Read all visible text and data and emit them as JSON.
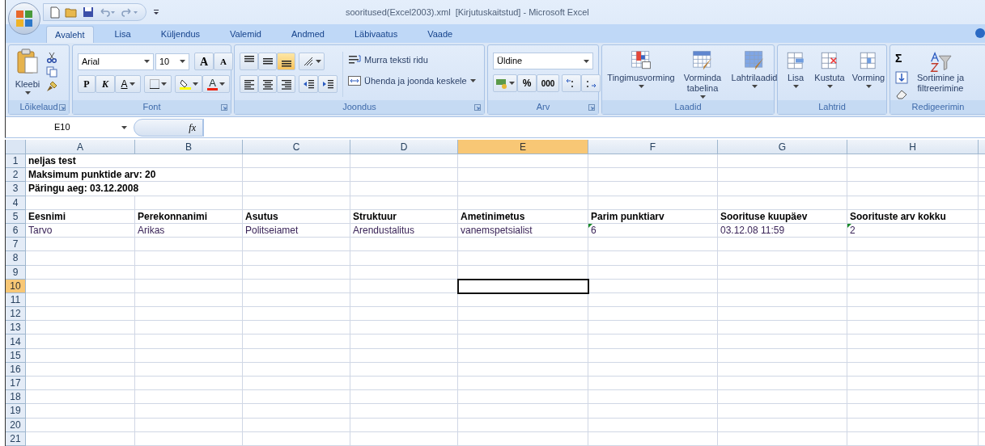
{
  "window": {
    "title": "sooritused(Excel2003).xml  [Kirjutuskaitstud] - Microsoft Excel"
  },
  "tabs": [
    {
      "label": "Avaleht",
      "selected": true
    },
    {
      "label": "Lisa",
      "selected": false
    },
    {
      "label": "Küljendus",
      "selected": false
    },
    {
      "label": "Valemid",
      "selected": false
    },
    {
      "label": "Andmed",
      "selected": false
    },
    {
      "label": "Läbivaatus",
      "selected": false
    },
    {
      "label": "Vaade",
      "selected": false
    }
  ],
  "ribbon": {
    "groups": [
      {
        "kind": "clipboard",
        "label": "Lõikelaud",
        "paste_label": "Kleebi"
      },
      {
        "kind": "font",
        "label": "Font",
        "font_name": "Arial",
        "font_size": "10",
        "grow_key": "A",
        "shrink_key": "A",
        "bold_key": "P",
        "italic_key": "K",
        "underline_key": "A",
        "font_color_key": "A"
      },
      {
        "kind": "alignment",
        "label": "Joondus",
        "vertical": [
          {
            "selected": false
          },
          {
            "selected": false
          },
          {
            "selected": true
          }
        ],
        "wrap_label": "Murra teksti ridu",
        "merge_label": "Ühenda ja joonda keskele"
      },
      {
        "kind": "number",
        "label": "Arv",
        "format": "Üldine",
        "percent_key": "%",
        "thousands_key": "000"
      },
      {
        "kind": "styles",
        "label": "Laadid",
        "buttons": [
          {
            "label": "Tingimusvorming"
          },
          {
            "label": "Vorminda tabelina"
          },
          {
            "label": "Lahtrilaadid"
          }
        ]
      },
      {
        "kind": "cells",
        "label": "Lahtrid",
        "buttons": [
          {
            "label": "Lisa"
          },
          {
            "label": "Kustuta"
          },
          {
            "label": "Vorming"
          }
        ]
      },
      {
        "kind": "editing",
        "label": "Redigeerimin",
        "sum_key": "Σ",
        "sort_label": "Sortimine ja filtreerimine"
      }
    ]
  },
  "formula_bar": {
    "name_box": "E10",
    "fx": "fx"
  },
  "sheet": {
    "columns": [
      {
        "label": "A",
        "selected": false
      },
      {
        "label": "B",
        "selected": false
      },
      {
        "label": "C",
        "selected": false
      },
      {
        "label": "D",
        "selected": false
      },
      {
        "label": "E",
        "selected": true
      },
      {
        "label": "F",
        "selected": false
      },
      {
        "label": "G",
        "selected": false
      },
      {
        "label": "H",
        "selected": false
      }
    ],
    "rows": [
      {
        "number": "1",
        "selected": false,
        "kind": "heading",
        "cells": [
          {
            "text": "neljas test"
          }
        ]
      },
      {
        "number": "2",
        "selected": false,
        "kind": "heading",
        "cells": [
          {
            "text": "Maksimum punktide arv: 20"
          }
        ]
      },
      {
        "number": "3",
        "selected": false,
        "kind": "heading",
        "cells": [
          {
            "text": "Päringu aeg: 03.12.2008"
          }
        ]
      },
      {
        "number": "4",
        "selected": false,
        "kind": "empty"
      },
      {
        "number": "5",
        "selected": false,
        "kind": "heading",
        "cells": [
          {
            "text": "Eesnimi"
          },
          {
            "text": "Perekonnanimi"
          },
          {
            "text": "Asutus"
          },
          {
            "text": "Struktuur"
          },
          {
            "text": "Ametinimetus"
          },
          {
            "text": "Parim punktiarv"
          },
          {
            "text": "Soorituse kuupäev"
          },
          {
            "text": "Soorituste arv kokku"
          }
        ]
      },
      {
        "number": "6",
        "selected": false,
        "kind": "data",
        "cells": [
          {
            "text": "Tarvo",
            "flagged": false
          },
          {
            "text": "Arikas",
            "flagged": false
          },
          {
            "text": "Politseiamet",
            "flagged": false
          },
          {
            "text": "Arendustalitus",
            "flagged": false
          },
          {
            "text": "vanemspetsialist",
            "flagged": false
          },
          {
            "text": "6",
            "flagged": true
          },
          {
            "text": "03.12.08 11:59",
            "flagged": false
          },
          {
            "text": "2",
            "flagged": true
          }
        ]
      },
      {
        "number": "7",
        "selected": false,
        "kind": "empty"
      },
      {
        "number": "8",
        "selected": false,
        "kind": "empty"
      },
      {
        "number": "9",
        "selected": false,
        "kind": "empty"
      },
      {
        "number": "10",
        "selected": true,
        "kind": "empty"
      },
      {
        "number": "11",
        "selected": false,
        "kind": "empty"
      },
      {
        "number": "12",
        "selected": false,
        "kind": "empty"
      },
      {
        "number": "13",
        "selected": false,
        "kind": "empty"
      },
      {
        "number": "14",
        "selected": false,
        "kind": "empty"
      },
      {
        "number": "15",
        "selected": false,
        "kind": "empty"
      },
      {
        "number": "16",
        "selected": false,
        "kind": "empty"
      },
      {
        "number": "17",
        "selected": false,
        "kind": "empty"
      },
      {
        "number": "18",
        "selected": false,
        "kind": "empty"
      },
      {
        "number": "19",
        "selected": false,
        "kind": "empty"
      },
      {
        "number": "20",
        "selected": false,
        "kind": "empty"
      },
      {
        "number": "21",
        "selected": false,
        "kind": "empty"
      }
    ]
  }
}
